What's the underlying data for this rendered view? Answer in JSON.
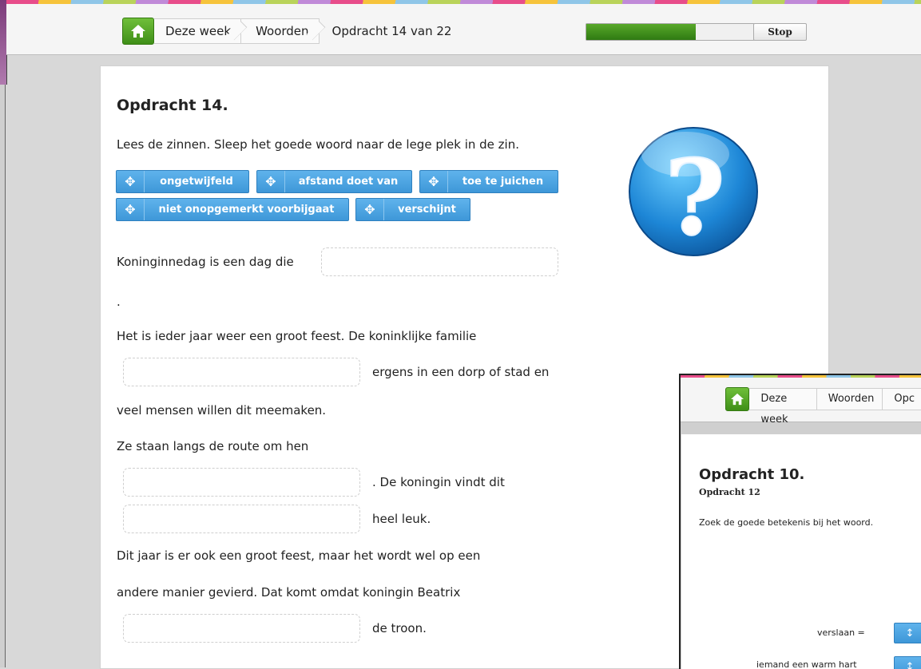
{
  "header": {
    "breadcrumb": [
      "Deze week",
      "Woorden"
    ],
    "current": "Opdracht 14 van 22",
    "progress": 0.65,
    "stop_label": "Stop"
  },
  "main": {
    "title": "Opdracht 14.",
    "instruction": "Lees de zinnen. Sleep het goede woord naar de lege plek in de zin.",
    "words": [
      "ongetwijfeld",
      "afstand doet van",
      "toe te juichen",
      "niet onopgemerkt voorbijgaat",
      "verschijnt"
    ],
    "sentences": {
      "s1": "Koninginnedag is een dag die",
      "s1_end": ".",
      "s2": "Het is ieder jaar weer een groot feest. De koninklijke familie",
      "s3_after": "ergens in een dorp of stad en",
      "s4": "veel mensen willen dit meemaken.",
      "s5": "Ze staan langs de route om hen",
      "s6_after": ". De koningin vindt dit",
      "s7_after": "heel leuk.",
      "s8": "Dit jaar is er ook een groot feest, maar het wordt wel op een",
      "s9": "andere manier gevierd. Dat komt omdat koningin Beatrix",
      "s10_after": "de troon."
    },
    "help_icon": "question-mark-icon"
  },
  "overlay": {
    "breadcrumb": [
      "Deze week",
      "Woorden",
      "Opc"
    ],
    "title": "Opdracht 10.",
    "subtitle": "Opdracht 12",
    "instruction": "Zoek de goede betekenis bij het woord.",
    "word1": "verslaan =",
    "word2": "iemand een warm hart"
  }
}
